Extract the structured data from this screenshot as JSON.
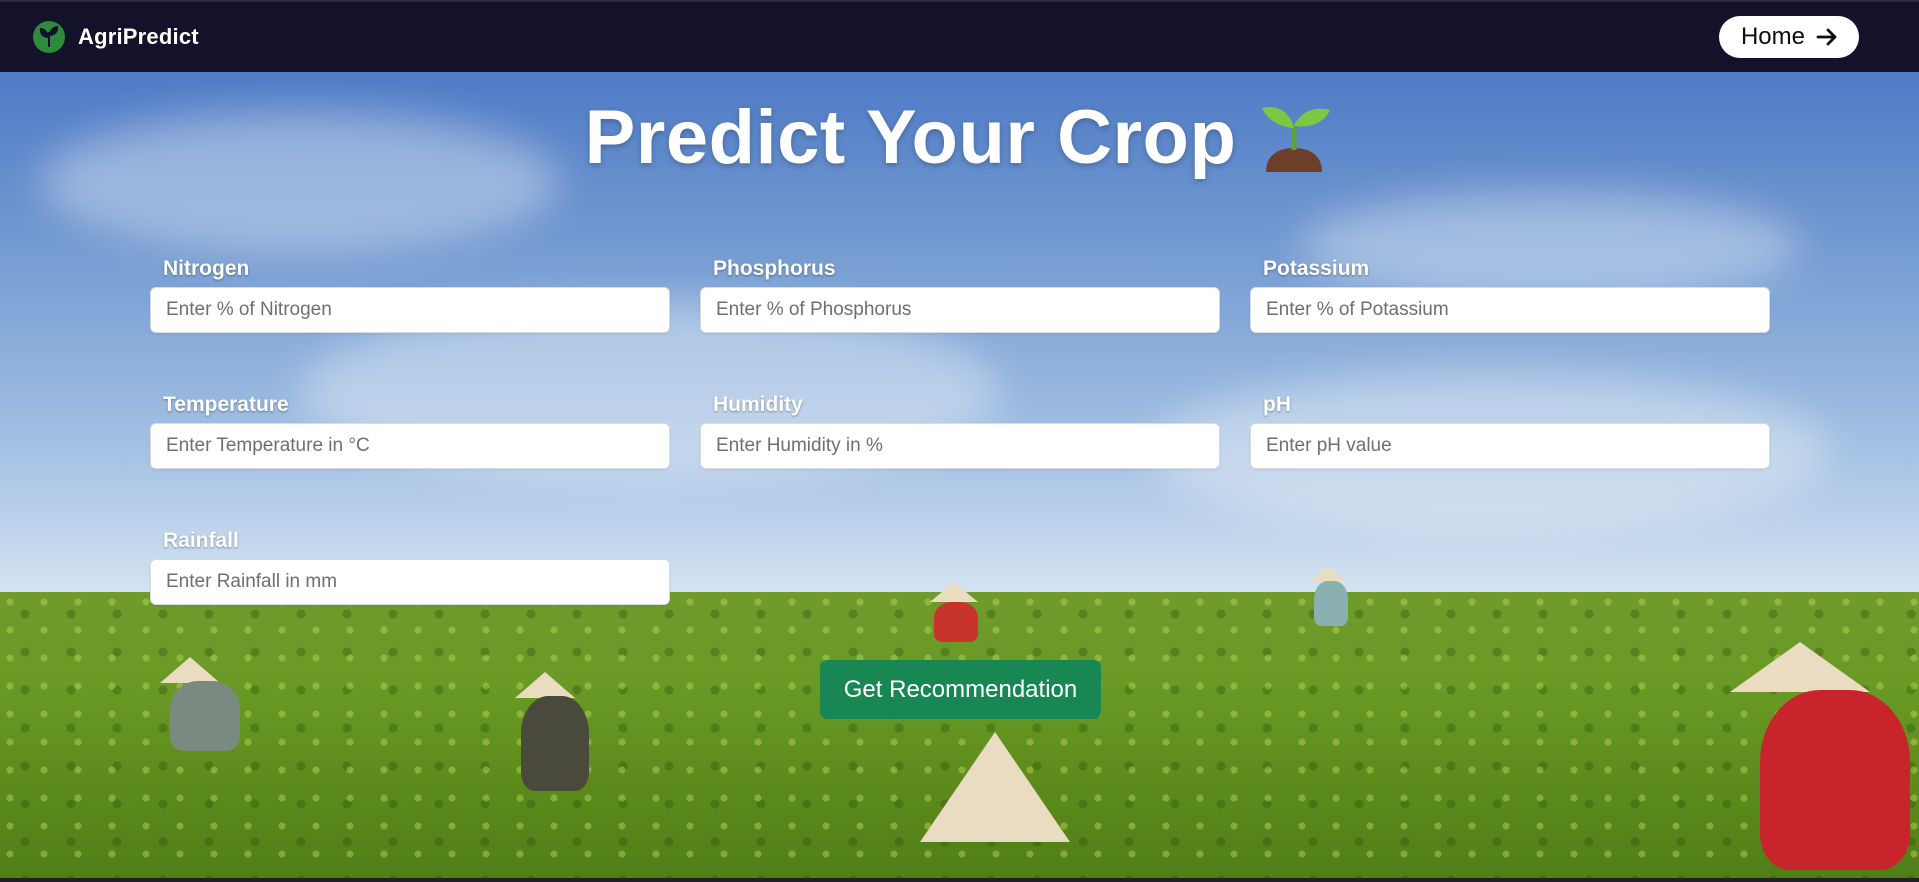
{
  "navbar": {
    "brand_name": "AgriPredict",
    "home_button_label": "Home",
    "colors": {
      "background": "#13122a",
      "logo": "#2e8b3d"
    }
  },
  "hero": {
    "title": "Predict Your Crop",
    "title_emoji": "seedling"
  },
  "form": {
    "fields": [
      {
        "label": "Nitrogen",
        "placeholder": "Enter % of Nitrogen",
        "value": ""
      },
      {
        "label": "Phosphorus",
        "placeholder": "Enter % of Phosphorus",
        "value": ""
      },
      {
        "label": "Potassium",
        "placeholder": "Enter % of Potassium",
        "value": ""
      },
      {
        "label": "Temperature",
        "placeholder": "Enter Temperature in °C",
        "value": ""
      },
      {
        "label": "Humidity",
        "placeholder": "Enter Humidity in %",
        "value": ""
      },
      {
        "label": "pH",
        "placeholder": "Enter pH value",
        "value": ""
      },
      {
        "label": "Rainfall",
        "placeholder": "Enter Rainfall in mm",
        "value": ""
      }
    ],
    "submit_label": "Get Recommendation",
    "submit_color": "#188754"
  }
}
